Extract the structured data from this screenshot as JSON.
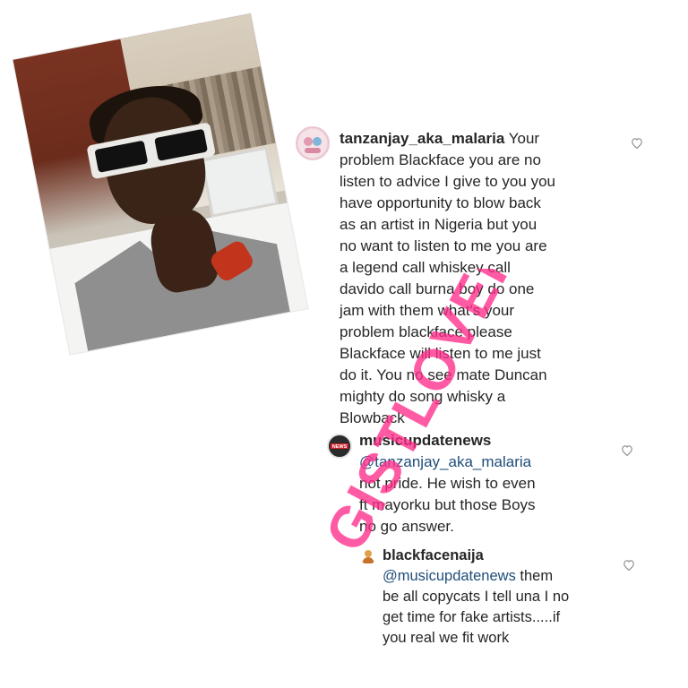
{
  "photo": {
    "alt": "Selfie of man in sunglasses"
  },
  "comments": [
    {
      "username": "tanzanjay_aka_malaria",
      "text_lines": [
        "Your",
        "problem Blackface you are no",
        "listen to advice I give to you you",
        "have opportunity to blow back",
        "as an artist in Nigeria but you",
        "no want to listen to me you are",
        "a legend call whiskey call",
        "davido call burna boy do one",
        "jam with them what's  your",
        "problem blackface please",
        "Blackface will listen to me just",
        "do it. You no see mate Duncan",
        "mighty do song whisky a",
        "Blowback"
      ],
      "avatar_icon": "profile-avatar"
    },
    {
      "username": "musicupdatenews",
      "mention": "@tanzanjay_aka_malaria",
      "text_lines": [
        "not pride. He wish to even",
        "ft mayorku but those Boys",
        "no go answer."
      ],
      "avatar_icon": "news-logo-avatar",
      "avatar_text": "NEWS"
    },
    {
      "username": "blackfacenaija",
      "mention": "@musicupdatenews",
      "mention_suffix": " them",
      "text_lines": [
        "be all copycats I tell una I no",
        "get time for fake artists.....if",
        "you real we fit work"
      ],
      "avatar_icon": "profile-avatar"
    }
  ],
  "icons": {
    "like": "heart-icon"
  },
  "watermark": {
    "text": "GISTLOVER.NG",
    "color": "#ff2d8a"
  },
  "colors": {
    "text": "#262626",
    "mention": "#1f4d7a",
    "icon": "#8e8e8e"
  }
}
